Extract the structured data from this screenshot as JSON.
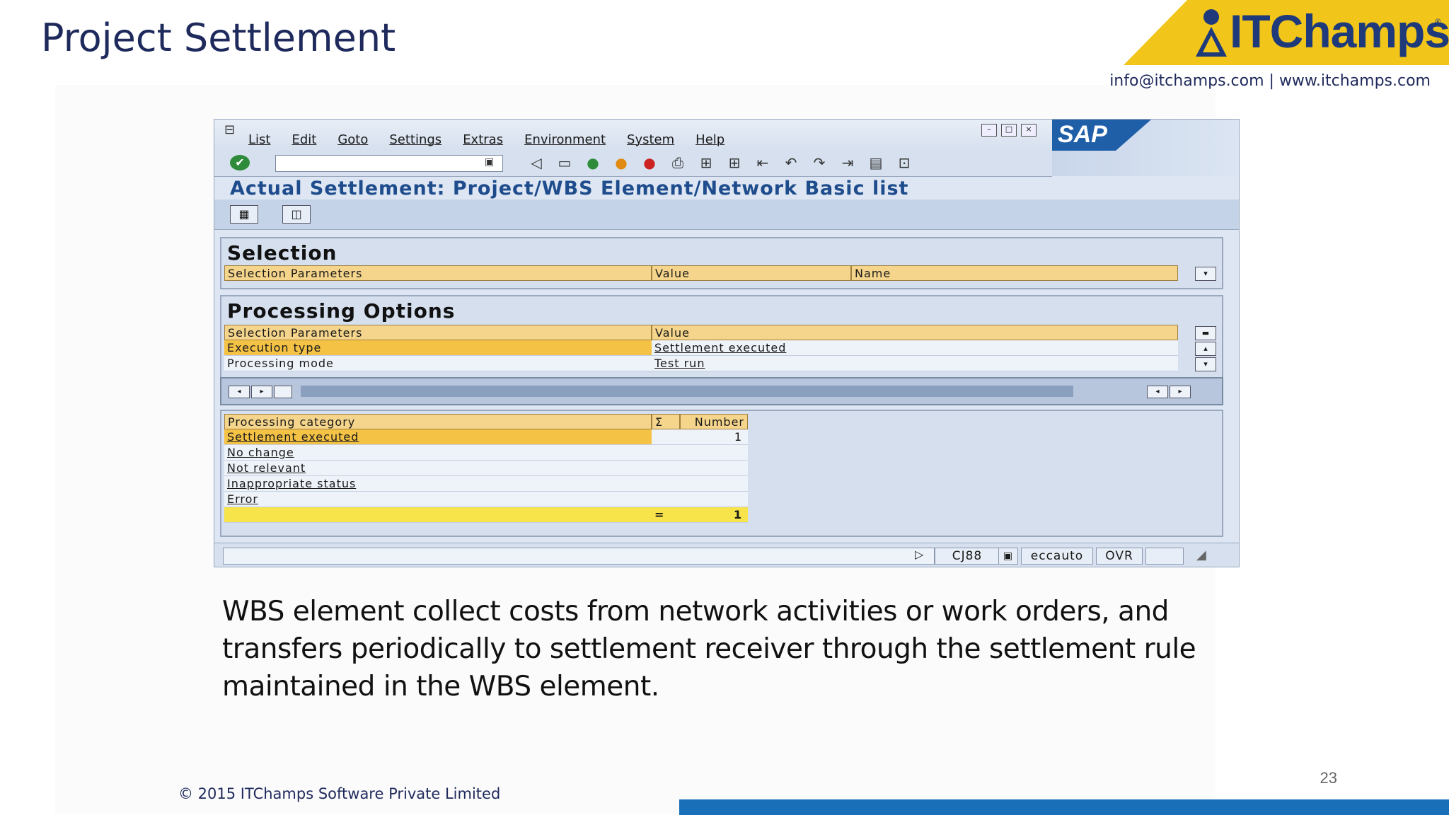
{
  "slide": {
    "title": "Project Settlement",
    "contact": "info@itchamps.com | www.itchamps.com",
    "page_number": "23",
    "copyright": "© 2015 ITChamps Software Private Limited",
    "caption": "WBS element collect costs from network activities or work orders, and transfers periodically to settlement receiver through the settlement rule maintained in the WBS element."
  },
  "logo": {
    "text": "ITChamps",
    "reg": "®",
    "brand_color": "#f2c51b"
  },
  "sap": {
    "menu": [
      "List",
      "Edit",
      "Goto",
      "Settings",
      "Extras",
      "Environment",
      "System",
      "Help"
    ],
    "logo_text": "SAP",
    "screen_title": "Actual Settlement: Project/WBS Element/Network Basic list",
    "selection": {
      "title": "Selection",
      "headers": [
        "Selection Parameters",
        "Value",
        "Name"
      ]
    },
    "processing_options": {
      "title": "Processing Options",
      "headers": [
        "Selection Parameters",
        "Value"
      ],
      "rows": [
        {
          "param": "Execution type",
          "value": "Settlement executed"
        },
        {
          "param": "Processing mode",
          "value": "Test run"
        }
      ]
    },
    "category_table": {
      "headers": [
        "Processing category",
        "Σ",
        "Number"
      ],
      "rows": [
        {
          "category": "Settlement executed",
          "number": "1"
        },
        {
          "category": "No change",
          "number": ""
        },
        {
          "category": "Not relevant",
          "number": ""
        },
        {
          "category": "Inappropriate status",
          "number": ""
        },
        {
          "category": "Error",
          "number": ""
        }
      ],
      "total_symbol": "=",
      "total": "1"
    },
    "status": {
      "transaction": "CJ88",
      "user": "eccauto",
      "mode": "OVR"
    }
  }
}
